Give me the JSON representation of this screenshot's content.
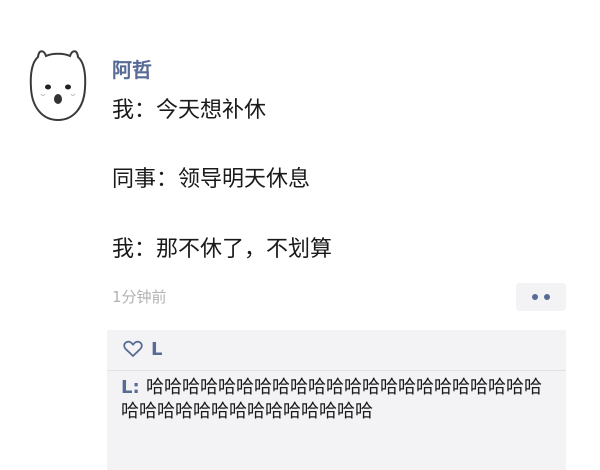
{
  "post": {
    "author": "阿哲",
    "lines": [
      "我：今天想补休",
      "同事：领导明天休息",
      "我：那不休了，不划算"
    ],
    "time": "1分钟前"
  },
  "likes": {
    "names": "L"
  },
  "comments": [
    {
      "author": "L",
      "separator": ": ",
      "text": "哈哈哈哈哈哈哈哈哈哈哈哈哈哈哈哈哈哈哈哈哈哈哈哈哈哈哈哈哈哈哈哈哈哈哈哈"
    }
  ],
  "icons": {
    "avatar": "cartoon-face-avatar",
    "like": "heart-outline-icon",
    "more": "more-dots-icon"
  },
  "colors": {
    "link": "#576b95",
    "text": "#1a1a1a",
    "muted": "#b2b2b2",
    "panel": "#f3f3f5"
  }
}
